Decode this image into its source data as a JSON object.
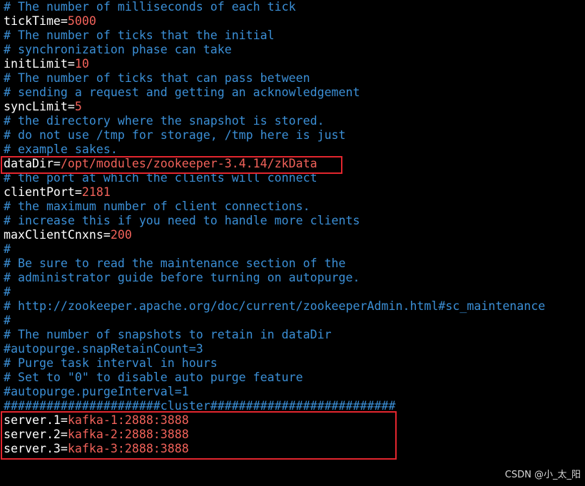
{
  "colors": {
    "background": "#000000",
    "comment": "#3b8fd6",
    "key": "#ffffff",
    "value": "#f2625a",
    "highlight_border": "#e3262e"
  },
  "lines": [
    {
      "comment": "# The number of milliseconds of each tick"
    },
    {
      "key": "tickTime=",
      "value": "5000"
    },
    {
      "comment": "# The number of ticks that the initial"
    },
    {
      "comment": "# synchronization phase can take"
    },
    {
      "key": "initLimit=",
      "value": "10"
    },
    {
      "comment": "# The number of ticks that can pass between"
    },
    {
      "comment": "# sending a request and getting an acknowledgement"
    },
    {
      "key": "syncLimit=",
      "value": "5"
    },
    {
      "comment": "# the directory where the snapshot is stored."
    },
    {
      "comment": "# do not use /tmp for storage, /tmp here is just"
    },
    {
      "comment": "# example sakes."
    },
    {
      "key": "dataDir=",
      "value": "/opt/modules/zookeeper-3.4.14/zkData"
    },
    {
      "comment": "# the port at which the clients will connect"
    },
    {
      "key": "clientPort=",
      "value": "2181"
    },
    {
      "comment": "# the maximum number of client connections."
    },
    {
      "comment": "# increase this if you need to handle more clients"
    },
    {
      "key": "maxClientCnxns=",
      "value": "200"
    },
    {
      "comment": "#"
    },
    {
      "comment": "# Be sure to read the maintenance section of the"
    },
    {
      "comment": "# administrator guide before turning on autopurge."
    },
    {
      "comment": "#"
    },
    {
      "comment": "# http://zookeeper.apache.org/doc/current/zookeeperAdmin.html#sc_maintenance"
    },
    {
      "comment": "#"
    },
    {
      "comment": "# The number of snapshots to retain in dataDir"
    },
    {
      "comment": "#autopurge.snapRetainCount=3"
    },
    {
      "comment": "# Purge task interval in hours"
    },
    {
      "comment": "# Set to \"0\" to disable auto purge feature"
    },
    {
      "comment": "#autopurge.purgeInterval=1"
    },
    {
      "comment": "######################cluster##########################"
    },
    {
      "key": "server.1=",
      "value": "kafka-1:2888:3888"
    },
    {
      "key": "server.2=",
      "value": "kafka-2:2888:3888"
    },
    {
      "key": "server.3=",
      "value": "kafka-3:2888:3888"
    }
  ],
  "watermark": "CSDN @小_太_阳"
}
